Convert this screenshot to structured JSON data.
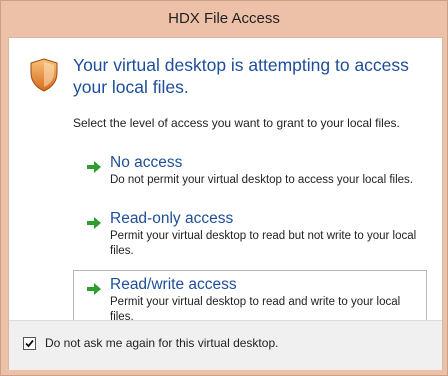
{
  "window": {
    "title": "HDX File Access"
  },
  "dialog": {
    "heading": "Your virtual desktop is attempting to access your local files.",
    "instruction": "Select the level of access you want to grant to your local files.",
    "icon": "shield-icon",
    "options": [
      {
        "title": "No access",
        "description": "Do not permit your virtual desktop to access your local files.",
        "icon": "green-arrow-icon",
        "selected": false
      },
      {
        "title": "Read-only access",
        "description": "Permit your virtual desktop to read but not write to your local files.",
        "icon": "green-arrow-icon",
        "selected": false
      },
      {
        "title": "Read/write access",
        "description": "Permit your virtual desktop to read and write to your local files.",
        "icon": "green-arrow-icon",
        "selected": true
      }
    ]
  },
  "footer": {
    "checkbox_label": "Do not ask me again for this virtual desktop.",
    "checkbox_checked": true
  },
  "colors": {
    "title_bar": "#edc1a8",
    "link_blue": "#1e4e99",
    "arrow_green": "#2e9e2e",
    "shield_orange": "#e6892b"
  }
}
